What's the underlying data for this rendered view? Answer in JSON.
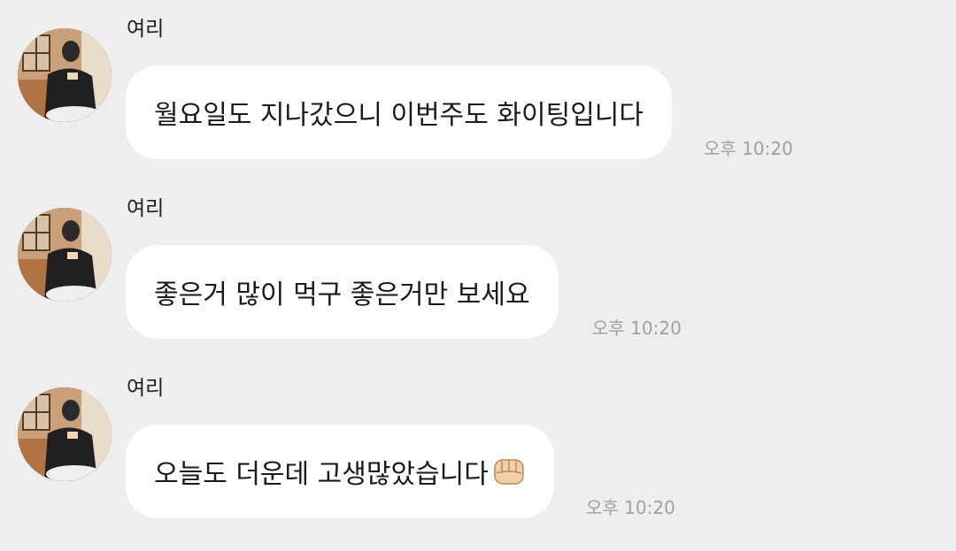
{
  "messages": [
    {
      "sender": "여리",
      "text": "월요일도 지나갔으니 이번주도 화이팅입니다",
      "time": "오후 10:20"
    },
    {
      "sender": "여리",
      "text": "좋은거 많이 먹구 좋은거만 보세요",
      "time": "오후 10:20"
    },
    {
      "sender": "여리",
      "text": "오늘도 더운데 고생많았습니다",
      "emoji": "fist-icon",
      "time": "오후 10:20"
    }
  ],
  "colors": {
    "background": "#eeeeee",
    "bubble": "#ffffff",
    "time_text": "#a0a0a0"
  }
}
